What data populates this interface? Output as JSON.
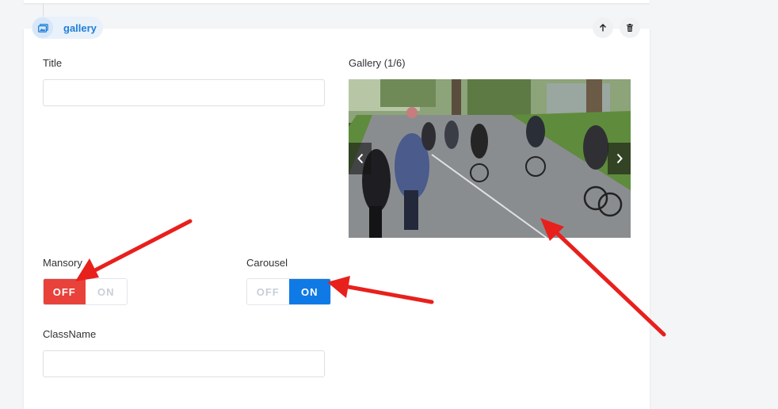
{
  "block": {
    "tag_label": "gallery",
    "tag_icon": "gallery-icon",
    "move_up_icon": "arrow-up-icon",
    "delete_icon": "trash-icon"
  },
  "fields": {
    "title_label": "Title",
    "title_value": "",
    "gallery_label": "Gallery (1/6)",
    "mansory_label": "Mansory",
    "mansory_off": "OFF",
    "mansory_on": "ON",
    "mansory_selected": "OFF",
    "carousel_label": "Carousel",
    "carousel_off": "OFF",
    "carousel_on": "ON",
    "carousel_selected": "ON",
    "classname_label": "ClassName",
    "classname_value": ""
  },
  "gallery": {
    "current_index": 1,
    "total": 6,
    "prev_icon": "chevron-left-icon",
    "next_icon": "chevron-right-icon"
  },
  "colors": {
    "accent_blue": "#0f7ae5",
    "off_red": "#e8423a",
    "annotation_red": "#e8201c",
    "tag_text": "#1f7fd8"
  },
  "annotations": [
    "arrow-to-mansory-off",
    "arrow-to-carousel-on",
    "arrow-to-gallery-image"
  ]
}
